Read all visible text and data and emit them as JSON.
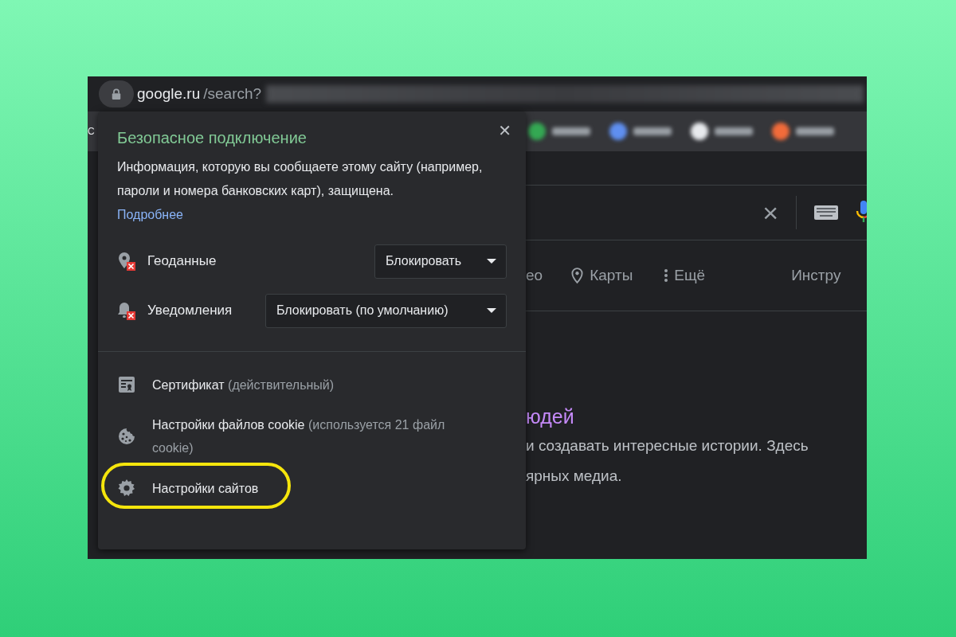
{
  "address_bar": {
    "domain": "google.ru",
    "path": "/search?"
  },
  "bookmarks_bar": {
    "partial_label": "С"
  },
  "search_box": {
    "clear_icon": "×"
  },
  "search_tabs": [
    {
      "kind": "text",
      "label": "ео"
    },
    {
      "kind": "maps",
      "label": "Карты"
    },
    {
      "kind": "more",
      "label": "Ещё"
    },
    {
      "kind": "tools",
      "label": "Инстру"
    }
  ],
  "result": {
    "title": "юдей",
    "snippet_lines": [
      "и создавать интересные истории. Здесь",
      "ярных медиа."
    ]
  },
  "site_info_popup": {
    "close": "✕",
    "title": "Безопасное подключение",
    "description": "Информация, которую вы сообщаете этому сайту (например, пароли и номера банковских карт), защищена.",
    "link": "Подробнее",
    "permissions": [
      {
        "kind": "location",
        "label": "Геоданные",
        "value": "Блокировать",
        "blocked": true
      },
      {
        "kind": "notifications",
        "label": "Уведомления",
        "value": "Блокировать (по умолчанию)",
        "blocked": true
      }
    ],
    "items": [
      {
        "kind": "certificate",
        "label": "Сертификат",
        "detail": "(действительный)",
        "highlighted": false
      },
      {
        "kind": "cookies",
        "label": "Настройки файлов cookie",
        "detail": "(используется 21 файл cookie)",
        "highlighted": false
      },
      {
        "kind": "site_settings",
        "label": "Настройки сайтов",
        "highlighted": true
      }
    ]
  }
}
